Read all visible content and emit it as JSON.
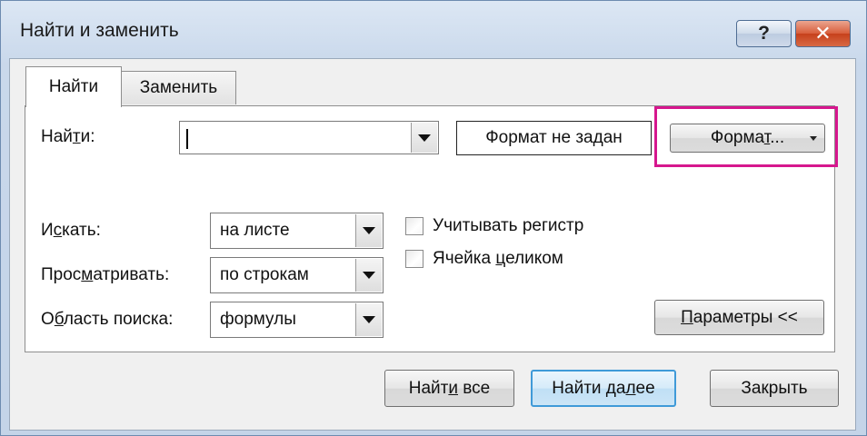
{
  "window": {
    "title": "Найти и заменить",
    "help_label": "?",
    "close_label": "✕"
  },
  "tabs": [
    {
      "label": "Найти",
      "active": true
    },
    {
      "label": "Заменить",
      "active": false
    }
  ],
  "find": {
    "label_pre": "Най",
    "label_u": "т",
    "label_post": "и:",
    "value": ""
  },
  "format_preview": "Формат не задан",
  "format_button": {
    "label_pre": "Форма",
    "label_u": "т",
    "label_post": "..."
  },
  "search": {
    "within": {
      "label_pre": "И",
      "label_u": "с",
      "label_post": "кать:",
      "value": "на листе"
    },
    "order": {
      "label_pre": "Прос",
      "label_u": "м",
      "label_post": "атривать:",
      "value": "по строкам"
    },
    "look_in": {
      "label_pre": "О",
      "label_u": "б",
      "label_post": "ласть поиска:",
      "value": "формулы"
    }
  },
  "checkboxes": {
    "match_case": {
      "label": "Учитывать регистр",
      "checked": false
    },
    "whole_cell": {
      "label_pre": "Ячейка ",
      "label_u": "ц",
      "label_post": "еликом",
      "checked": false
    }
  },
  "options_button": {
    "label_pre": "",
    "label_u": "П",
    "label_post": "араметры <<"
  },
  "buttons": {
    "find_all": {
      "label_pre": "Найт",
      "label_u": "и",
      "label_post": " все"
    },
    "find_next": {
      "label_pre": "Найти да",
      "label_u": "л",
      "label_post": "ее"
    },
    "close": {
      "label": "Закрыть"
    }
  },
  "colors": {
    "highlight": "#d6178e",
    "default_button_border": "#3f9ad8",
    "close_red": "#c6401b"
  }
}
